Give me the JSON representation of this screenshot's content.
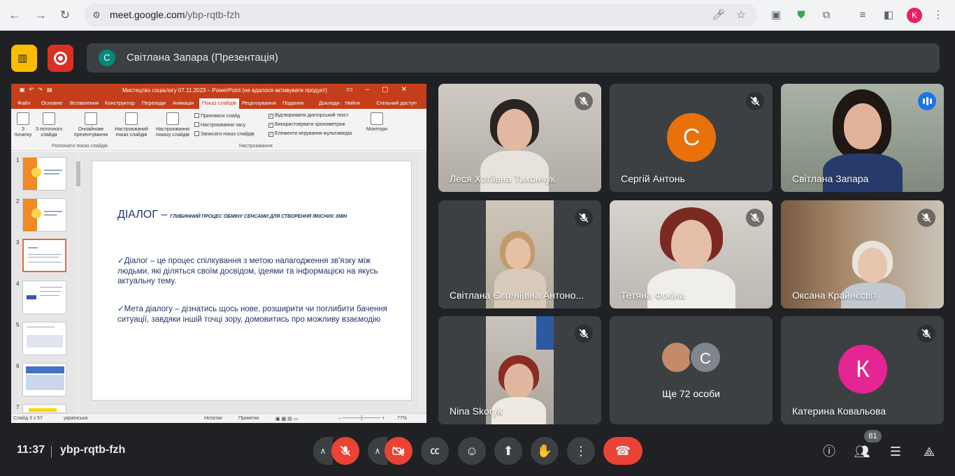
{
  "browser": {
    "url_host": "meet.google.com",
    "url_path": "/ybp-rqtb-fzh",
    "profile_initial": "K"
  },
  "meet": {
    "presenting_initial": "С",
    "presenting_label": "Світлана Запара (Презентація)",
    "time": "11:37",
    "meeting_code": "ybp-rqtb-fzh",
    "participants_count": "81"
  },
  "ppt": {
    "title": "Мистецтво соціалогу 07.11.2023 – PowerPoint (не вдалося активувати продукт)",
    "tabs": [
      "Файл",
      "Основне",
      "Вставлення",
      "Конструктор",
      "Переходи",
      "Анімація",
      "Показ слайдів",
      "Рецензування",
      "Подання",
      "Докладн",
      "Увійти"
    ],
    "share": "Спільний доступ",
    "ribbon": {
      "from_start": "З\nпочатку",
      "from_current": "З поточного\nслайда",
      "online": "Онлайнове\nпрезентування",
      "custom": "Настроюваний\nпоказ слайдів",
      "setup": "Настроювання\nпоказу слайдів",
      "hide": "Приховати слайд",
      "rehearse": "Настроювання часу",
      "record": "Записати показ слайдів",
      "play_narr": "Відтворювати дикторський текст",
      "use_timings": "Використовувати хронометраж",
      "media_ctrl": "Елементи керування мультимедіа",
      "monitor": "Монітори",
      "group1": "Розпочати показ слайдів",
      "group2": "Настроювання"
    },
    "thumb_numbers": [
      "1",
      "2",
      "3",
      "4",
      "5",
      "6",
      "7"
    ],
    "slide": {
      "title": "ДІАЛОГ –",
      "subtitle": "ГЛИБИННИЙ ПРОЦЕС ОБМІНУ СЕНСАМИ ДЛЯ СТВОРЕННЯ ЯКІСНИХ ЗМІН",
      "para1": "✓Діалог – це процес спілкування з метою налагодження зв'язку між людьми, які діляться своїм досвідом, ідеями та інформацією на якусь актуальну тему.",
      "para2": "✓Мета діалогу – дізнатись щось нове, розширити чи поглибити бачення ситуації, завдяки іншій точці зору, домовитись про можливу взаємодію"
    },
    "status": {
      "slide": "Слайд 3 з 57",
      "lang": "українська",
      "notes": "Нотатки",
      "comments": "Примітки",
      "zoom": "77%"
    }
  },
  "tiles": [
    {
      "name": "Леся Хотіївна Тихончук"
    },
    {
      "name": "Сергій Антонь",
      "initial": "С",
      "color": "#e8710a"
    },
    {
      "name": "Світлана Запара"
    },
    {
      "name": "Світлана Євгеніївна Антоно..."
    },
    {
      "name": "Тетяна Фокіна"
    },
    {
      "name": "Оксана Крайнєсвіт"
    },
    {
      "name": "Nina Skoryk"
    },
    {
      "name": "Ще 72 особи",
      "initial": "С"
    },
    {
      "name": "Катерина Ковальова",
      "initial": "К",
      "color": "#e52592"
    }
  ]
}
